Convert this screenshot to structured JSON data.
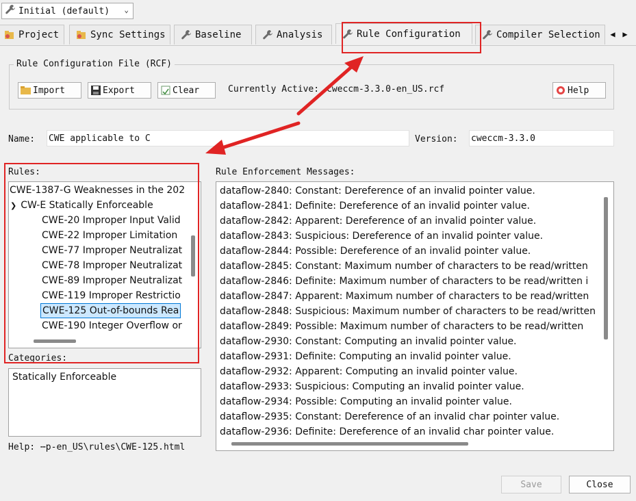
{
  "profile_combo": {
    "value": "Initial (default)"
  },
  "tabs": [
    {
      "label": "Project"
    },
    {
      "label": "Sync Settings"
    },
    {
      "label": "Baseline"
    },
    {
      "label": "Analysis"
    },
    {
      "label": "Rule Configuration"
    },
    {
      "label": "Compiler Selection"
    }
  ],
  "rcf_group": {
    "title": "Rule Configuration File (RCF)",
    "import_label": "Import",
    "export_label": "Export",
    "clear_label": "Clear",
    "active_label": "Currently Active:",
    "active_value": "cweccm-3.3.0-en_US.rcf",
    "help_label": "Help"
  },
  "name_label": "Name:",
  "name_value": "CWE applicable to C",
  "version_label": "Version:",
  "version_value": "cweccm-3.3.0",
  "rules": {
    "label": "Rules:",
    "items": [
      {
        "text": "CWE-1387-G Weaknesses in the 202"
      },
      {
        "text": "CW-E Statically Enforceable"
      },
      {
        "text": "CWE-20 Improper Input Valid"
      },
      {
        "text": "CWE-22 Improper Limitation"
      },
      {
        "text": "CWE-77 Improper Neutralizat"
      },
      {
        "text": "CWE-78 Improper Neutralizat"
      },
      {
        "text": "CWE-89 Improper Neutralizat"
      },
      {
        "text": "CWE-119 Improper Restrictio"
      },
      {
        "text": "CWE-125 Out-of-bounds Rea"
      },
      {
        "text": "CWE-190 Integer Overflow or"
      }
    ]
  },
  "categories": {
    "label": "Categories:",
    "value": "Statically Enforceable"
  },
  "help_path": "Help: ⋯p-en_US\\rules\\CWE-125.html",
  "messages": {
    "label": "Rule Enforcement Messages:",
    "items": [
      "dataflow-2840: Constant: Dereference of an invalid pointer value.",
      "dataflow-2841: Definite: Dereference of an invalid pointer value.",
      "dataflow-2842: Apparent: Dereference of an invalid pointer value.",
      "dataflow-2843: Suspicious: Dereference of an invalid pointer value.",
      "dataflow-2844: Possible: Dereference of an invalid pointer value.",
      "dataflow-2845: Constant: Maximum number of characters to be read/written",
      "dataflow-2846: Definite: Maximum number of characters to be read/written i",
      "dataflow-2847: Apparent: Maximum number of characters to be read/written",
      "dataflow-2848: Suspicious: Maximum number of characters to be read/written",
      "dataflow-2849: Possible: Maximum number of characters to be read/written",
      "dataflow-2930: Constant: Computing an invalid pointer value.",
      "dataflow-2931: Definite: Computing an invalid pointer value.",
      "dataflow-2932: Apparent: Computing an invalid pointer value.",
      "dataflow-2933: Suspicious: Computing an invalid pointer value.",
      "dataflow-2934: Possible: Computing an invalid pointer value.",
      "dataflow-2935: Constant: Dereference of an invalid char pointer value.",
      "dataflow-2936: Definite: Dereference of an invalid char pointer value."
    ]
  },
  "footer": {
    "save_label": "Save",
    "close_label": "Close"
  },
  "colors": {
    "annotation_red": "#e02424",
    "selection_bg": "#cce8ff",
    "selection_border": "#0078d7"
  }
}
